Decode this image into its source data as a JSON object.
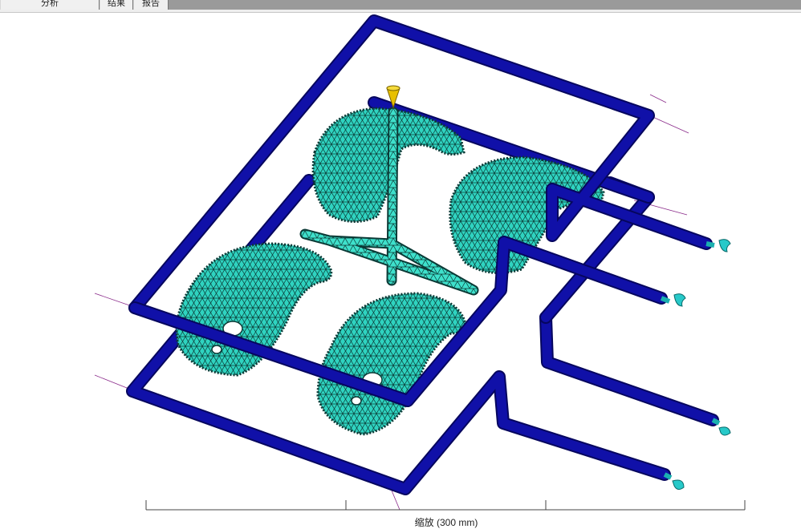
{
  "tabs": [
    {
      "label": "分析"
    },
    {
      "label": "结果"
    },
    {
      "label": "报告"
    }
  ],
  "scale": {
    "label": "缩放 (300 mm)"
  },
  "colors": {
    "channel": "#1010a8",
    "channel_edge": "#06065e",
    "mesh": "#2fd3c0",
    "mesh_line": "#0b3a36",
    "inlet": "#e8c000",
    "axis": "#8a2a8a",
    "tabbar": "#9a9a9a"
  }
}
